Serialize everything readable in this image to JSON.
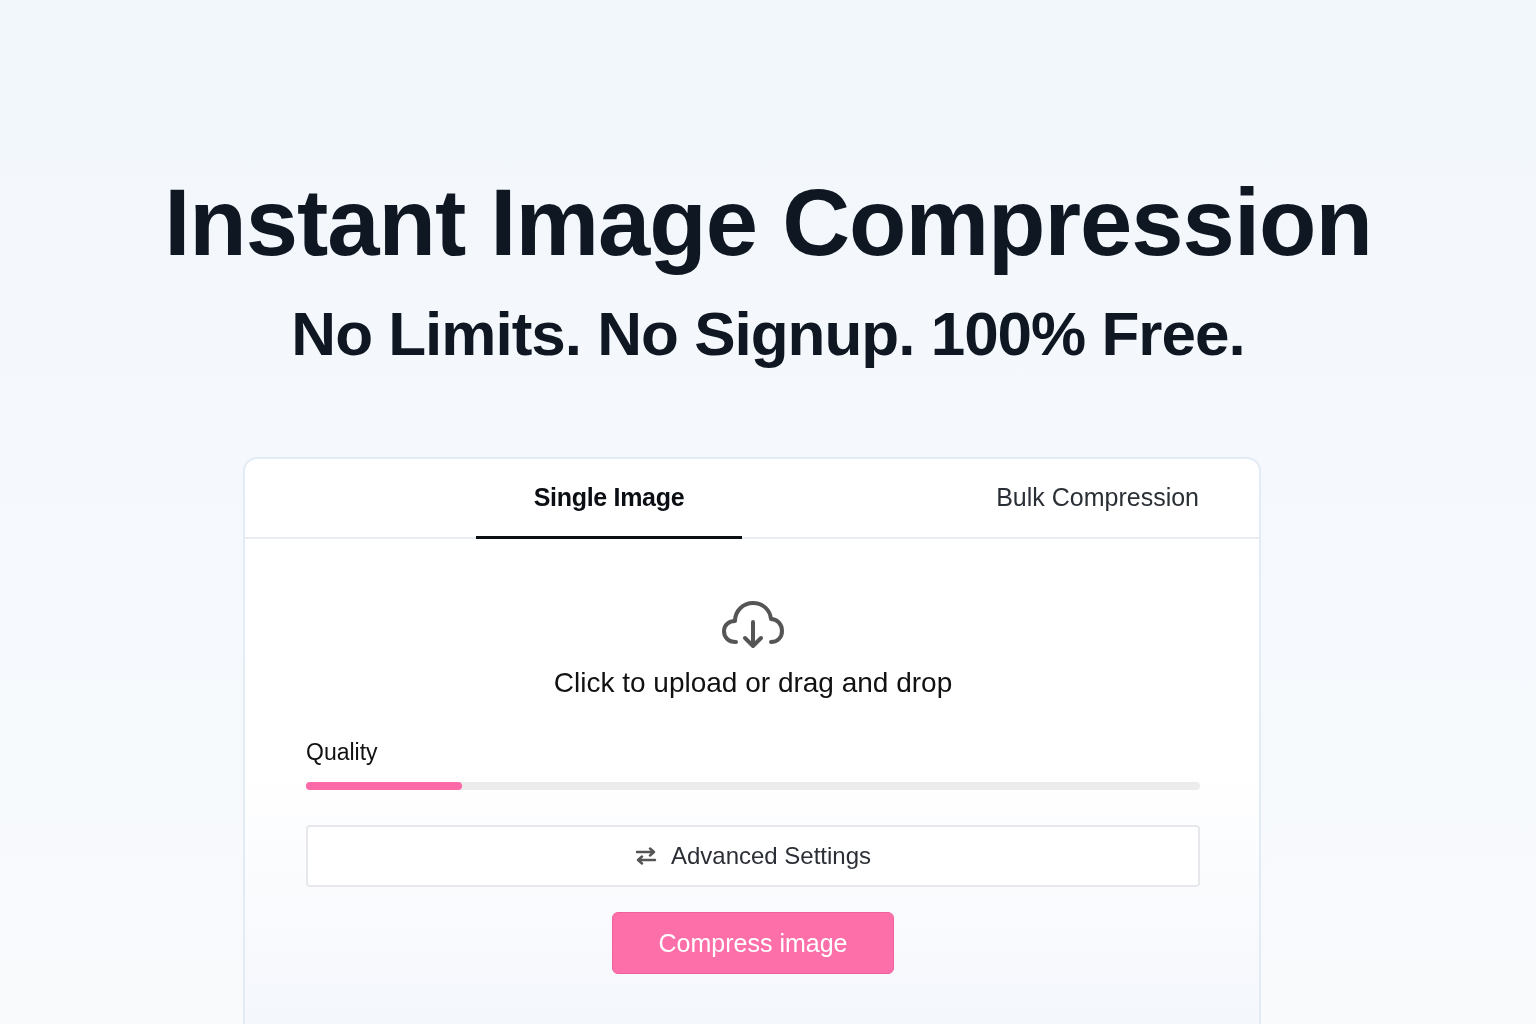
{
  "hero": {
    "title": "Instant Image Compression",
    "subtitle": "No Limits. No Signup. 100% Free."
  },
  "card": {
    "tabs": [
      {
        "label": "Single Image",
        "selected": true
      },
      {
        "label": "Bulk Compression",
        "selected": false
      }
    ],
    "upload": {
      "prompt": "Click to upload or drag and drop"
    },
    "quality": {
      "label": "Quality",
      "level": 0.175
    },
    "advanced_button": {
      "label": "Advanced Settings"
    },
    "compress_button": {
      "label": "Compress image"
    }
  }
}
